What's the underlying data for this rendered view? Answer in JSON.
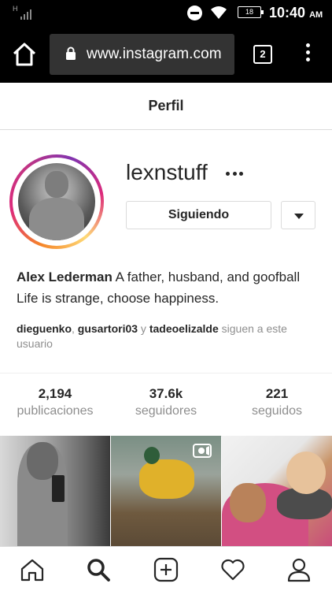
{
  "status_bar": {
    "network": "H",
    "battery": "18",
    "time": "10:40",
    "ampm": "AM"
  },
  "browser": {
    "url": "www.instagram.com",
    "tab_count": "2"
  },
  "header": {
    "title": "Perfil"
  },
  "profile": {
    "username": "lexnstuff",
    "follow_button": "Siguiendo",
    "bio_name": "Alex Lederman",
    "bio_text": " A father, husband, and goofball Life is strange, choose happiness.",
    "followed_by": {
      "user1": "dieguenko",
      "sep1": ", ",
      "user2": "gusartori03",
      "sep2": " y ",
      "user3": "tadeoelizalde",
      "suffix": " siguen a este usuario"
    }
  },
  "stats": [
    {
      "value": "2,194",
      "label": "publicaciones"
    },
    {
      "value": "37.6k",
      "label": "seguidores"
    },
    {
      "value": "221",
      "label": "seguidos"
    }
  ],
  "grid": [
    {
      "type": "photo"
    },
    {
      "type": "video"
    },
    {
      "type": "photo"
    }
  ],
  "bottom_nav": [
    "home-icon",
    "search-icon",
    "new-post-icon",
    "activity-heart-icon",
    "profile-icon"
  ],
  "colors": {
    "text": "#262626",
    "muted": "#8e8e8e",
    "border": "#dbdbdb",
    "ring_start": "#f58529",
    "ring_end": "#c13584"
  }
}
